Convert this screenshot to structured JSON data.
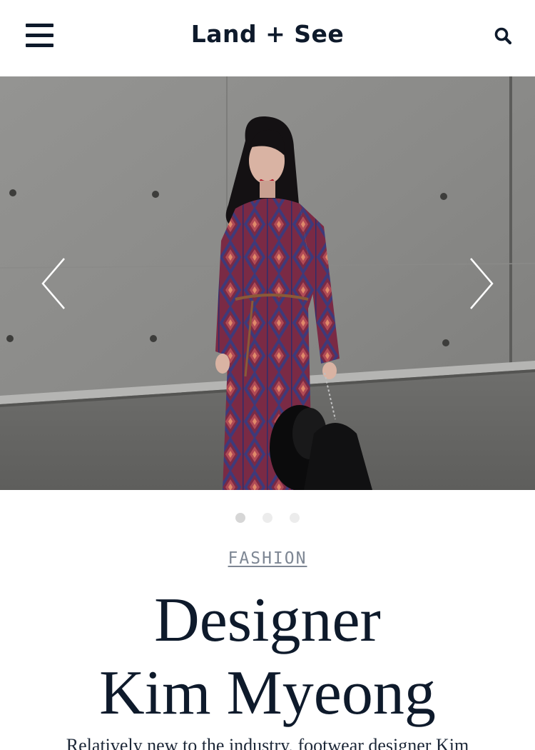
{
  "header": {
    "site_title": "Land + See",
    "menu_icon": "hamburger-menu-icon",
    "search_icon": "search-icon"
  },
  "slider": {
    "prev_icon": "chevron-left-icon",
    "next_icon": "chevron-right-icon",
    "slide_count": 3,
    "active_slide": 1,
    "slide_image": "woman in patterned burgundy long-sleeve dress holding black hat and bag in front of concrete wall"
  },
  "article": {
    "category": "FASHION",
    "title_line1": "Designer",
    "title_line2": "Kim Myeong",
    "excerpt": "Relatively new to the industry, footwear designer Kim"
  },
  "colors": {
    "text_dark": "#0e1a2b",
    "category_gray": "#7e8794",
    "dot_active": "#d6d6d6",
    "dot_inactive": "#ececec"
  }
}
